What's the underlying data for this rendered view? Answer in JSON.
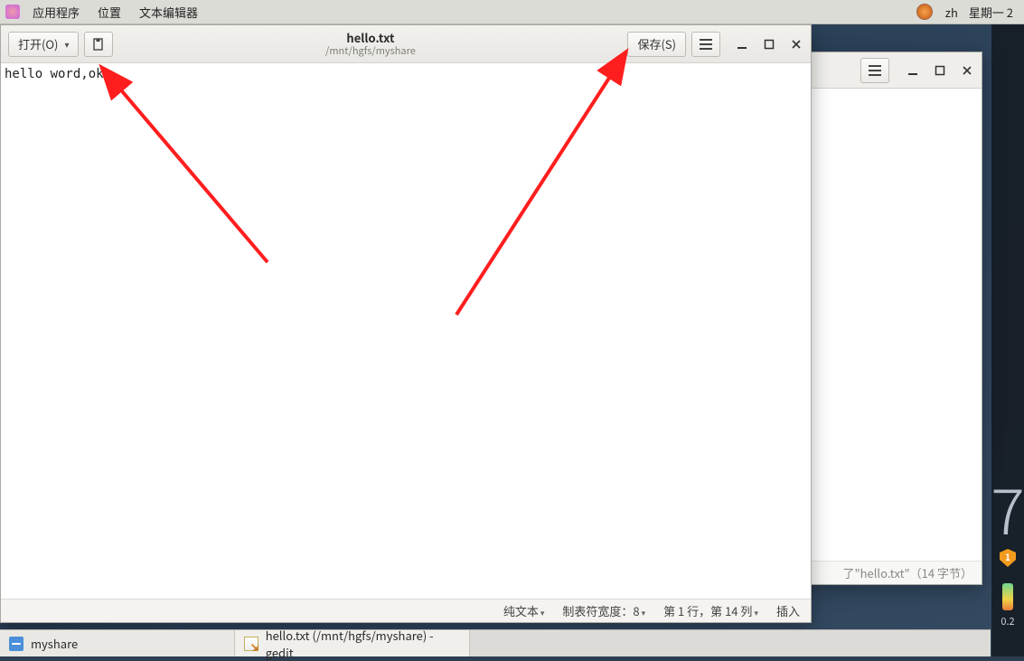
{
  "top_menu": {
    "applications": "应用程序",
    "places": "位置",
    "text_editor": "文本编辑器",
    "ime": "zh",
    "date": "星期一 2"
  },
  "bg_window": {
    "status": "了\"hello.txt\"（14 字节）"
  },
  "editor": {
    "open_label": "打开(O)",
    "save_label": "保存(S)",
    "title": "hello.txt",
    "subtitle": "/mnt/hgfs/myshare",
    "content": "hello word,ok",
    "status": {
      "language": "纯文本",
      "tab_width": "制表符宽度：8",
      "position": "第 1 行，第 14 列",
      "mode": "插入"
    }
  },
  "taskbar": {
    "item1": "myshare",
    "item2": "hello.txt (/mnt/hgfs/myshare) - gedit"
  },
  "sidebar": {
    "big_number": "7",
    "gauge_value": "0.2"
  }
}
